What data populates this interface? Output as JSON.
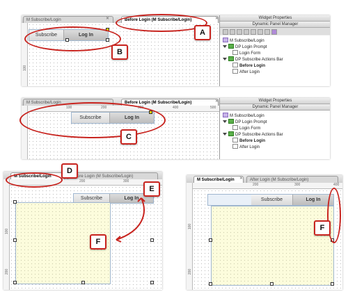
{
  "panel1": {
    "tabs": [
      "M Subscribe/Login",
      "Before Login (M Subscribe/Login)"
    ],
    "ruler_v": "100",
    "buttons": {
      "subscribe": "Subscribe",
      "login": "Log In"
    },
    "sidebar": {
      "title1": "Widget Properties",
      "title2": "Dynamic Panel Manager",
      "items": [
        "M Subscribe/Login",
        "DP Login Prompt",
        "Login Form",
        "DP Subscribe Actions Bar",
        "Before Login",
        "After Login"
      ]
    },
    "callouts": {
      "a": "A",
      "b": "B"
    }
  },
  "panel2": {
    "tabs": [
      "M Subscribe/Login",
      "Before Login (M Subscribe/Login)"
    ],
    "ruler": [
      "100",
      "200",
      "300",
      "400",
      "500"
    ],
    "buttons": {
      "subscribe": "Subscribe",
      "login": "Log In"
    },
    "sidebar": {
      "title1": "Widget Properties",
      "title2": "Dynamic Panel Manager",
      "items": [
        "M Subscribe/Login",
        "DP Login Prompt",
        "Login Form",
        "DP Subscribe Actions Bar",
        "Before Login",
        "After Login"
      ]
    },
    "callouts": {
      "c": "C"
    }
  },
  "panel3": {
    "tabs": [
      "M Subscribe/Login",
      "Before Login (M Subscribe/Login)"
    ],
    "ruler_h": [
      "200",
      "300"
    ],
    "ruler_v": [
      "100",
      "200"
    ],
    "buttons": {
      "subscribe": "Subscribe",
      "login": "Log In"
    },
    "callouts": {
      "d": "D",
      "e": "E",
      "f": "F"
    }
  },
  "panel4": {
    "tabs": [
      "M Subscribe/Login",
      "After Login (M Subscribe/Login)"
    ],
    "ruler_h": [
      "200",
      "300",
      "400"
    ],
    "ruler_v": [
      "100",
      "200"
    ],
    "buttons": {
      "subscribe": "Subscribe",
      "login": "Log In"
    },
    "callouts": {
      "f": "F"
    }
  },
  "colors": {
    "callout_red": "#c8241f",
    "panel_yellow": "#fcfcdc",
    "bar_blue": "#e9f0f8"
  }
}
